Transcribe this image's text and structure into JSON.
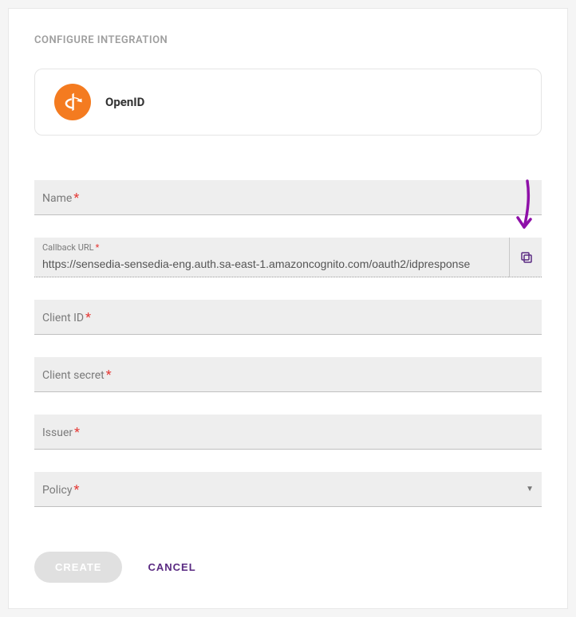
{
  "section_title": "CONFIGURE INTEGRATION",
  "provider": {
    "name": "OpenID"
  },
  "fields": {
    "name_label": "Name",
    "callback_label": "Callback URL",
    "callback_value": "https://sensedia-sensedia-eng.auth.sa-east-1.amazoncognito.com/oauth2/idpresponse",
    "client_id_label": "Client ID",
    "client_secret_label": "Client secret",
    "issuer_label": "Issuer",
    "policy_label": "Policy"
  },
  "actions": {
    "create_label": "CREATE",
    "cancel_label": "CANCEL"
  }
}
